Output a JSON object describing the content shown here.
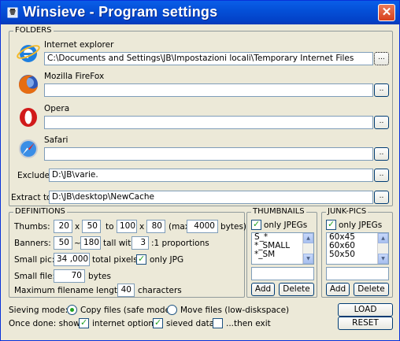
{
  "window": {
    "title": "Winsieve - Program settings",
    "close_glyph": "✕"
  },
  "folders": {
    "legend": "FOLDERS",
    "ie": {
      "label": "Internet explorer",
      "value": "C:\\Documents and Settings\\JB\\Impostazioni locali\\Temporary Internet Files",
      "browse": "..."
    },
    "firefox": {
      "label": "Mozilla FireFox",
      "value": "",
      "browse": ".."
    },
    "opera": {
      "label": "Opera",
      "value": "",
      "browse": ".."
    },
    "safari": {
      "label": "Safari",
      "value": "",
      "browse": ".."
    },
    "exclude": {
      "label": "Exclude",
      "value": "D:\\JB\\varie.",
      "browse": ".."
    },
    "extract": {
      "label": "Extract to",
      "value": "D:\\JB\\desktop\\NewCache",
      "browse": ".."
    }
  },
  "definitions": {
    "legend": "DEFINITIONS",
    "thumbs": {
      "label": "Thumbs:",
      "w1": "20",
      "x1": "x",
      "h1": "50",
      "to": "to",
      "w2": "100",
      "x2": "x",
      "h2": "80",
      "max_pre": "(max.",
      "max": "4000",
      "max_post": "bytes)"
    },
    "banners": {
      "label": "Banners:",
      "min": "50",
      "tilde": "~",
      "max": "180",
      "tall_with": "tall with",
      "ratio": "3",
      "proportions": ":1 proportions"
    },
    "small_pic": {
      "label": "Small pic:",
      "value": "34 ,000",
      "suffix": "total pixels",
      "only_jpg_label": "only JPG",
      "only_jpg_checked": true
    },
    "small_file": {
      "label": "Small file:",
      "value": "70",
      "suffix": "bytes"
    },
    "max_len": {
      "label": "Maximum filename length:",
      "value": "40",
      "suffix": "characters"
    }
  },
  "thumbnails": {
    "legend": "THUMBNAILS",
    "only_jpegs_label": "only JPEGs",
    "only_jpegs_checked": true,
    "items": [
      "S_*",
      "*_SMALL",
      "*_SM"
    ],
    "add": "Add",
    "delete": "Delete"
  },
  "junk": {
    "legend": "JUNK-PICS",
    "only_jpegs_label": "only JPEGs",
    "only_jpegs_checked": true,
    "items": [
      "60x45",
      "60x60",
      "50x50"
    ],
    "add": "Add",
    "delete": "Delete"
  },
  "bottom": {
    "sieving_label": "Sieving mode:",
    "copy_label": "Copy files (safe mode)",
    "copy_selected": true,
    "move_label": "Move files (low-diskspace)",
    "move_selected": false,
    "once_done_label": "Once done: show",
    "internet_options_label": "internet options",
    "internet_options_checked": true,
    "sieved_data_label": "sieved data",
    "sieved_data_checked": true,
    "then_exit_label": "...then exit",
    "then_exit_checked": false,
    "load": "LOAD",
    "reset": "RESET"
  }
}
